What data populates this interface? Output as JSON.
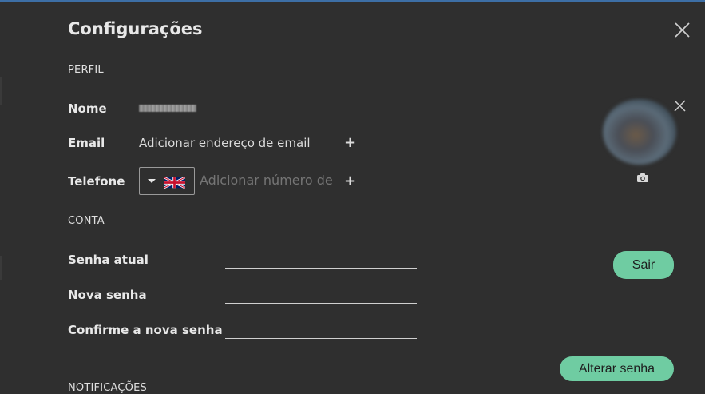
{
  "dialog": {
    "title": "Configurações"
  },
  "profile": {
    "section_title": "PERFIL",
    "name_label": "Nome",
    "email_label": "Email",
    "email_link": "Adicionar endereço de email",
    "phone_label": "Telefone",
    "phone_placeholder": "Adicionar número de te",
    "avatar": {
      "camera_icon": "camera-icon",
      "remove_icon": "close-icon"
    }
  },
  "account": {
    "section_title": "CONTA",
    "current_password_label": "Senha atual",
    "new_password_label": "Nova senha",
    "confirm_password_label": "Confirme a nova senha",
    "logout_button": "Sair",
    "change_password_button": "Alterar senha"
  },
  "notifications": {
    "section_title": "NOTIFICAÇÕES"
  },
  "colors": {
    "background": "#2f2f2f",
    "accent_button": "#6fcca2",
    "top_border": "#3d6fa6"
  }
}
